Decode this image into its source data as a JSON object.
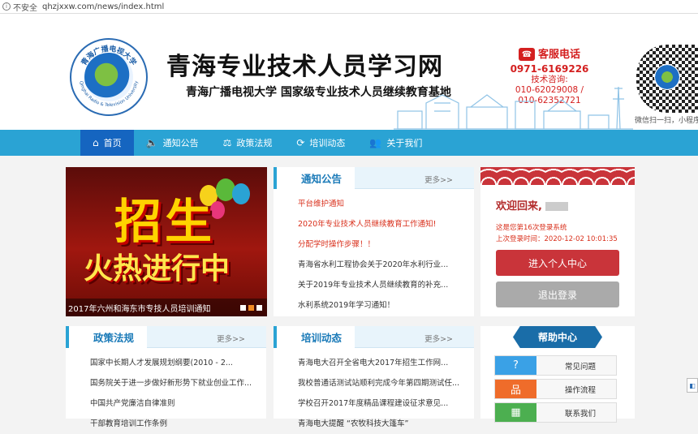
{
  "browser": {
    "security": "不安全",
    "url": "qhzjxxw.com/news/index.html"
  },
  "header": {
    "title": "青海专业技术人员学习网",
    "subtitle": "青海广播电视大学  国家级专业技术人员继续教育基地",
    "logo_text": "青海广播电视大学",
    "logo_text_en": "Qinghai Radio & Television University",
    "hotline_label": "客服电话",
    "hotline": "0971-6169226",
    "consult_label": "技术咨询:",
    "consult_numbers": "010-62029008 / 010-62352721",
    "qr_caption": "微信扫一扫，小程序学"
  },
  "nav": {
    "items": [
      {
        "label": "首页",
        "icon": "home-icon",
        "glyph": "⌂"
      },
      {
        "label": "通知公告",
        "icon": "speaker-icon",
        "glyph": "🔈"
      },
      {
        "label": "政策法规",
        "icon": "scale-icon",
        "glyph": "⚖"
      },
      {
        "label": "培训动态",
        "icon": "refresh-icon",
        "glyph": "⟳"
      },
      {
        "label": "关于我们",
        "icon": "users-icon",
        "glyph": "👥"
      }
    ]
  },
  "banner": {
    "line1": "招生",
    "line2": "火热进行中",
    "caption": "2017年六州和海东市专技人员培训通知"
  },
  "notice": {
    "title": "通知公告",
    "more": "更多>>",
    "items": [
      {
        "text": "平台维护通知",
        "color": "#d9301c"
      },
      {
        "text": "2020年专业技术人员继续教育工作通知!",
        "color": "#d9301c"
      },
      {
        "text": "分配学时操作步骤！！",
        "color": "#d9301c"
      },
      {
        "text": "青海省水利工程协会关于2020年水利行业...",
        "color": "#333333"
      },
      {
        "text": "关于2019年专业技术人员继续教育的补充...",
        "color": "#333333"
      },
      {
        "text": "水利系统2019年学习通知！",
        "color": "#333333"
      }
    ]
  },
  "login": {
    "welcome": "欢迎回来,",
    "login_count": "这是您第16次登录系统",
    "last_login": "上次登录时间：2020-12-02 10:01:35",
    "enter_label": "进入个人中心",
    "logout_label": "退出登录"
  },
  "policy": {
    "title": "政策法规",
    "more": "更多>>",
    "items": [
      "国家中长期人才发展规划纲要(2010 - 2...",
      "国务院关于进一步做好新形势下就业创业工作...",
      "中国共产党廉洁自律准则",
      "干部教育培训工作条例"
    ]
  },
  "training": {
    "title": "培训动态",
    "more": "更多>>",
    "items": [
      "青海电大召开全省电大2017年招生工作网...",
      "我校普通话测试站顺利完成今年第四期测试任...",
      "学校召开2017年度精品课程建设征求意见...",
      "青海电大提醒 “农牧科技大篷车”"
    ]
  },
  "help": {
    "title": "帮助中心",
    "items": [
      {
        "label": "常见问题",
        "icon": "question-icon",
        "glyph": "?",
        "color": "#3aa1e6"
      },
      {
        "label": "操作流程",
        "icon": "flowchart-icon",
        "glyph": "品",
        "color": "#ef6c2a"
      },
      {
        "label": "联系我们",
        "icon": "building-icon",
        "glyph": "▦",
        "color": "#4caf50"
      }
    ]
  }
}
